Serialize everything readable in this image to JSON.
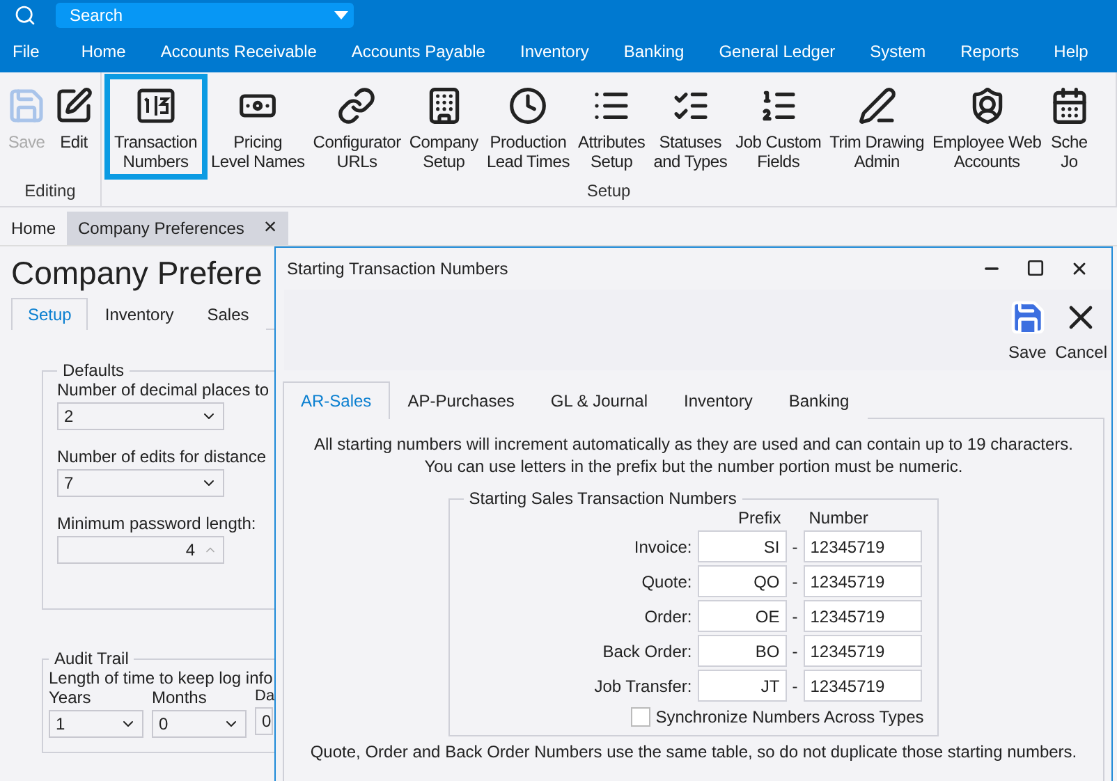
{
  "search": {
    "placeholder": "Search"
  },
  "menu": [
    {
      "label": "File"
    },
    {
      "label": "Home"
    },
    {
      "label": "Accounts Receivable"
    },
    {
      "label": "Accounts Payable"
    },
    {
      "label": "Inventory"
    },
    {
      "label": "Banking"
    },
    {
      "label": "General Ledger"
    },
    {
      "label": "System"
    },
    {
      "label": "Reports"
    },
    {
      "label": "Help"
    }
  ],
  "ribbon": [
    {
      "group": "Editing",
      "buttons": [
        {
          "lines": [
            "Save"
          ],
          "disabled": true,
          "selected": false
        },
        {
          "lines": [
            "Edit"
          ],
          "disabled": false,
          "selected": false
        }
      ]
    },
    {
      "group": "Setup",
      "buttons": [
        {
          "lines": [
            "Transaction",
            "Numbers"
          ],
          "disabled": false,
          "selected": true
        },
        {
          "lines": [
            "Pricing",
            "Level Names"
          ],
          "disabled": false,
          "selected": false
        },
        {
          "lines": [
            "Configurator",
            "URLs"
          ],
          "disabled": false,
          "selected": false
        },
        {
          "lines": [
            "Company",
            "Setup"
          ],
          "disabled": false,
          "selected": false
        },
        {
          "lines": [
            "Production",
            "Lead Times"
          ],
          "disabled": false,
          "selected": false
        },
        {
          "lines": [
            "Attributes",
            "Setup"
          ],
          "disabled": false,
          "selected": false
        },
        {
          "lines": [
            "Statuses",
            "and Types"
          ],
          "disabled": false,
          "selected": false
        },
        {
          "lines": [
            "Job Custom",
            "Fields"
          ],
          "disabled": false,
          "selected": false
        },
        {
          "lines": [
            "Trim Drawing",
            "Admin"
          ],
          "disabled": false,
          "selected": false
        },
        {
          "lines": [
            "Employee Web",
            "Accounts"
          ],
          "disabled": false,
          "selected": false
        },
        {
          "lines": [
            "Sche",
            "Jo"
          ],
          "disabled": false,
          "selected": false
        }
      ]
    }
  ],
  "doc_tabs": [
    {
      "label": "Home",
      "selected": false
    },
    {
      "label": "Company Preferences",
      "selected": true,
      "close": "×"
    }
  ],
  "page": {
    "title": "Company Prefere",
    "tabs": [
      {
        "label": "Setup",
        "selected": true
      },
      {
        "label": "Inventory",
        "selected": false
      },
      {
        "label": "Sales",
        "selected": false
      }
    ],
    "defaults": {
      "legend": "Defaults",
      "decimal_label": "Number of decimal places to",
      "decimal_value": "2",
      "edits_label": "Number of edits for distance",
      "edits_value": "7",
      "password_label": "Minimum password length:",
      "password_value": "4"
    },
    "audit": {
      "legend": "Audit Trail",
      "label": "Length of time to keep log info",
      "fields": [
        {
          "label": "Years",
          "value": "1"
        },
        {
          "label": "Months",
          "value": "0"
        },
        {
          "label": "Da",
          "value": "0"
        }
      ]
    }
  },
  "dialog": {
    "title": "Starting Transaction Numbers",
    "actions": [
      {
        "label": "Save"
      },
      {
        "label": "Cancel"
      }
    ],
    "tabs": [
      {
        "label": "AR-Sales",
        "selected": true
      },
      {
        "label": "AP-Purchases",
        "selected": false
      },
      {
        "label": "GL & Journal",
        "selected": false
      },
      {
        "label": "Inventory",
        "selected": false
      },
      {
        "label": "Banking",
        "selected": false
      }
    ],
    "info": [
      "All starting numbers will increment automatically as they are used and can contain up to 19 characters.",
      "You can use letters in the prefix but the number portion must be numeric."
    ],
    "group": {
      "legend": "Starting Sales Transaction Numbers",
      "prefix_header": "Prefix",
      "number_header": "Number",
      "separator": "-",
      "rows": [
        {
          "label": "Invoice:",
          "prefix": "SI",
          "number": "12345719"
        },
        {
          "label": "Quote:",
          "prefix": "QO",
          "number": "12345719"
        },
        {
          "label": "Order:",
          "prefix": "OE",
          "number": "12345719"
        },
        {
          "label": "Back Order:",
          "prefix": "BO",
          "number": "12345719"
        },
        {
          "label": "Job Transfer:",
          "prefix": "JT",
          "number": "12345719"
        }
      ],
      "sync": {
        "label": "Synchronize Numbers Across Types",
        "checked": false
      }
    },
    "footer": "Quote, Order and Back Order Numbers use the same table, so do not duplicate those starting numbers."
  }
}
